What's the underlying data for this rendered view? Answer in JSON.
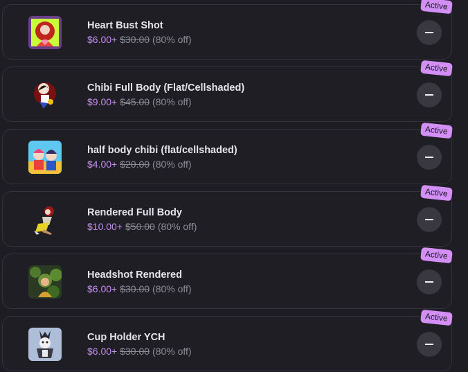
{
  "items": [
    {
      "title": "Heart Bust Shot",
      "price": "$6.00+",
      "original": "$30.00",
      "discount": "(80% off)",
      "badge": "Active",
      "thumb_icon": "heart-bust-art-icon"
    },
    {
      "title": "Chibi Full Body (Flat/Cellshaded)",
      "price": "$9.00+",
      "original": "$45.00",
      "discount": "(80% off)",
      "badge": "Active",
      "thumb_icon": "chibi-full-body-art-icon"
    },
    {
      "title": "half body chibi (flat/cellshaded)",
      "price": "$4.00+",
      "original": "$20.00",
      "discount": "(80% off)",
      "badge": "Active",
      "thumb_icon": "half-body-chibi-art-icon"
    },
    {
      "title": "Rendered Full Body",
      "price": "$10.00+",
      "original": "$50.00",
      "discount": "(80% off)",
      "badge": "Active",
      "thumb_icon": "rendered-full-body-art-icon"
    },
    {
      "title": "Headshot Rendered",
      "price": "$6.00+",
      "original": "$30.00",
      "discount": "(80% off)",
      "badge": "Active",
      "thumb_icon": "headshot-rendered-art-icon"
    },
    {
      "title": "Cup Holder YCH",
      "price": "$6.00+",
      "original": "$30.00",
      "discount": "(80% off)",
      "badge": "Active",
      "thumb_icon": "cup-holder-ych-art-icon"
    }
  ],
  "remove_button_icon": "minus-icon",
  "colors": {
    "background": "#1e1d24",
    "card_border": "#34333b",
    "price_accent": "#c58df0",
    "badge_background": "#d38ff6",
    "button_background": "#393841"
  }
}
